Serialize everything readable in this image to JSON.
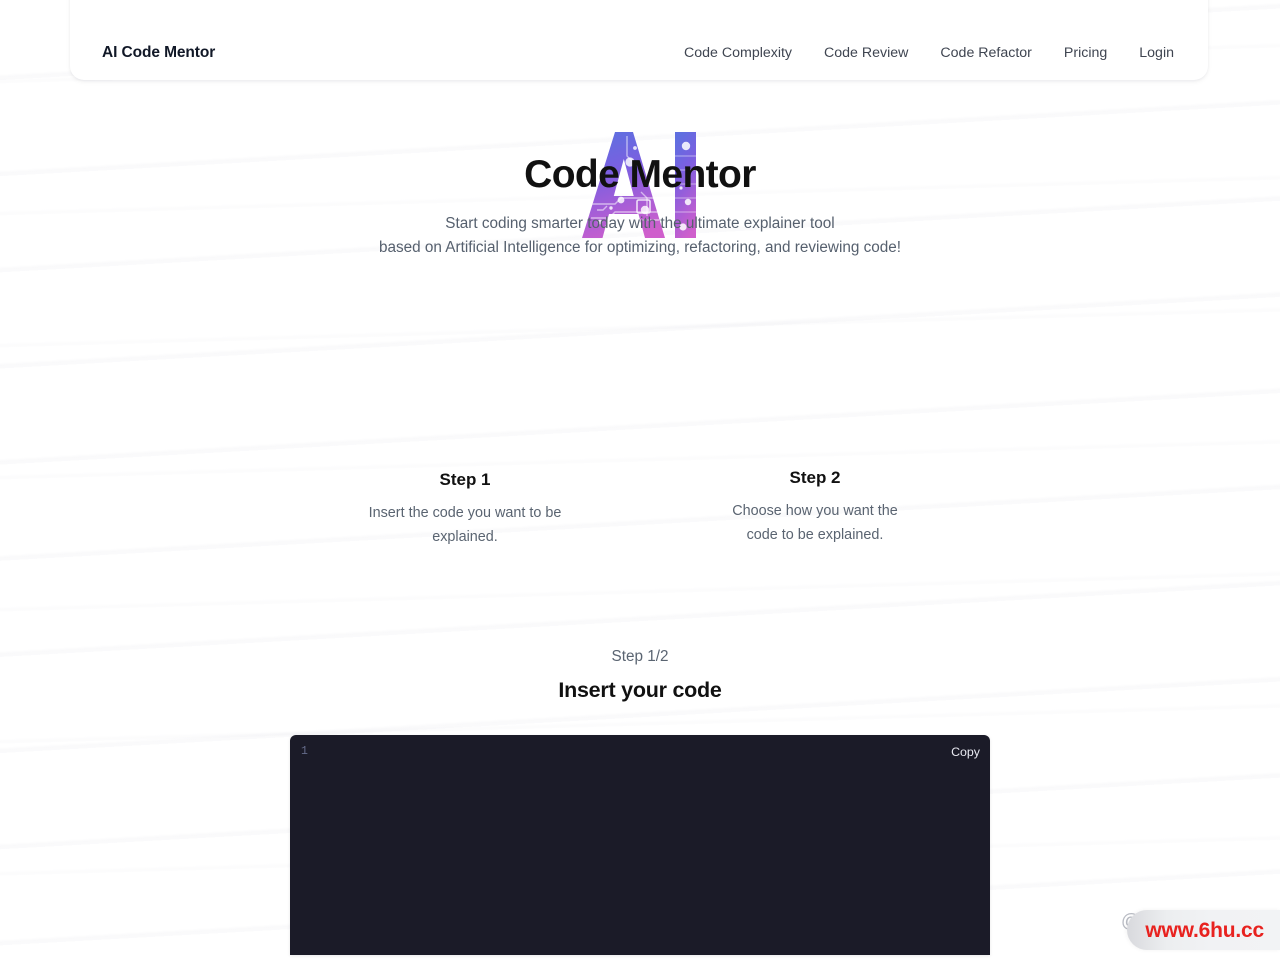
{
  "header": {
    "brand": "AI Code Mentor",
    "nav": [
      {
        "label": "Code Complexity",
        "name": "nav-link-code-complexity"
      },
      {
        "label": "Code Review",
        "name": "nav-link-code-review"
      },
      {
        "label": "Code Refactor",
        "name": "nav-link-code-refactor"
      },
      {
        "label": "Pricing",
        "name": "nav-link-pricing"
      },
      {
        "label": "Login",
        "name": "nav-link-login"
      }
    ]
  },
  "hero": {
    "logo_text": "AI",
    "logo_icon": "ai-circuit-logo-icon",
    "title": "Code Mentor",
    "subtitle_line1": "Start coding smarter today with the ultimate explainer tool",
    "subtitle_line2": "based on Artificial Intelligence for optimizing, refactoring, and reviewing code!"
  },
  "steps": [
    {
      "title": "Step 1",
      "desc_line1": "Insert the code you want to be",
      "desc_line2": "explained."
    },
    {
      "title": "Step 2",
      "desc_line1": "Choose how you want the",
      "desc_line2": "code to be explained."
    }
  ],
  "editor": {
    "step_counter": "Step 1/2",
    "heading": "Insert your code",
    "line_number": "1",
    "copy_label": "Copy",
    "code_value": "",
    "code_placeholder": ""
  },
  "watermark": {
    "handle": "@f",
    "badge_text": "www.6hu.cc"
  },
  "colors": {
    "logo_gradient_start": "#6b5ce7",
    "logo_gradient_end": "#c25fd0",
    "editor_bg": "#1b1b28",
    "text_primary": "#111111",
    "text_muted": "#5a6471",
    "watermark_red": "#e8221f"
  }
}
